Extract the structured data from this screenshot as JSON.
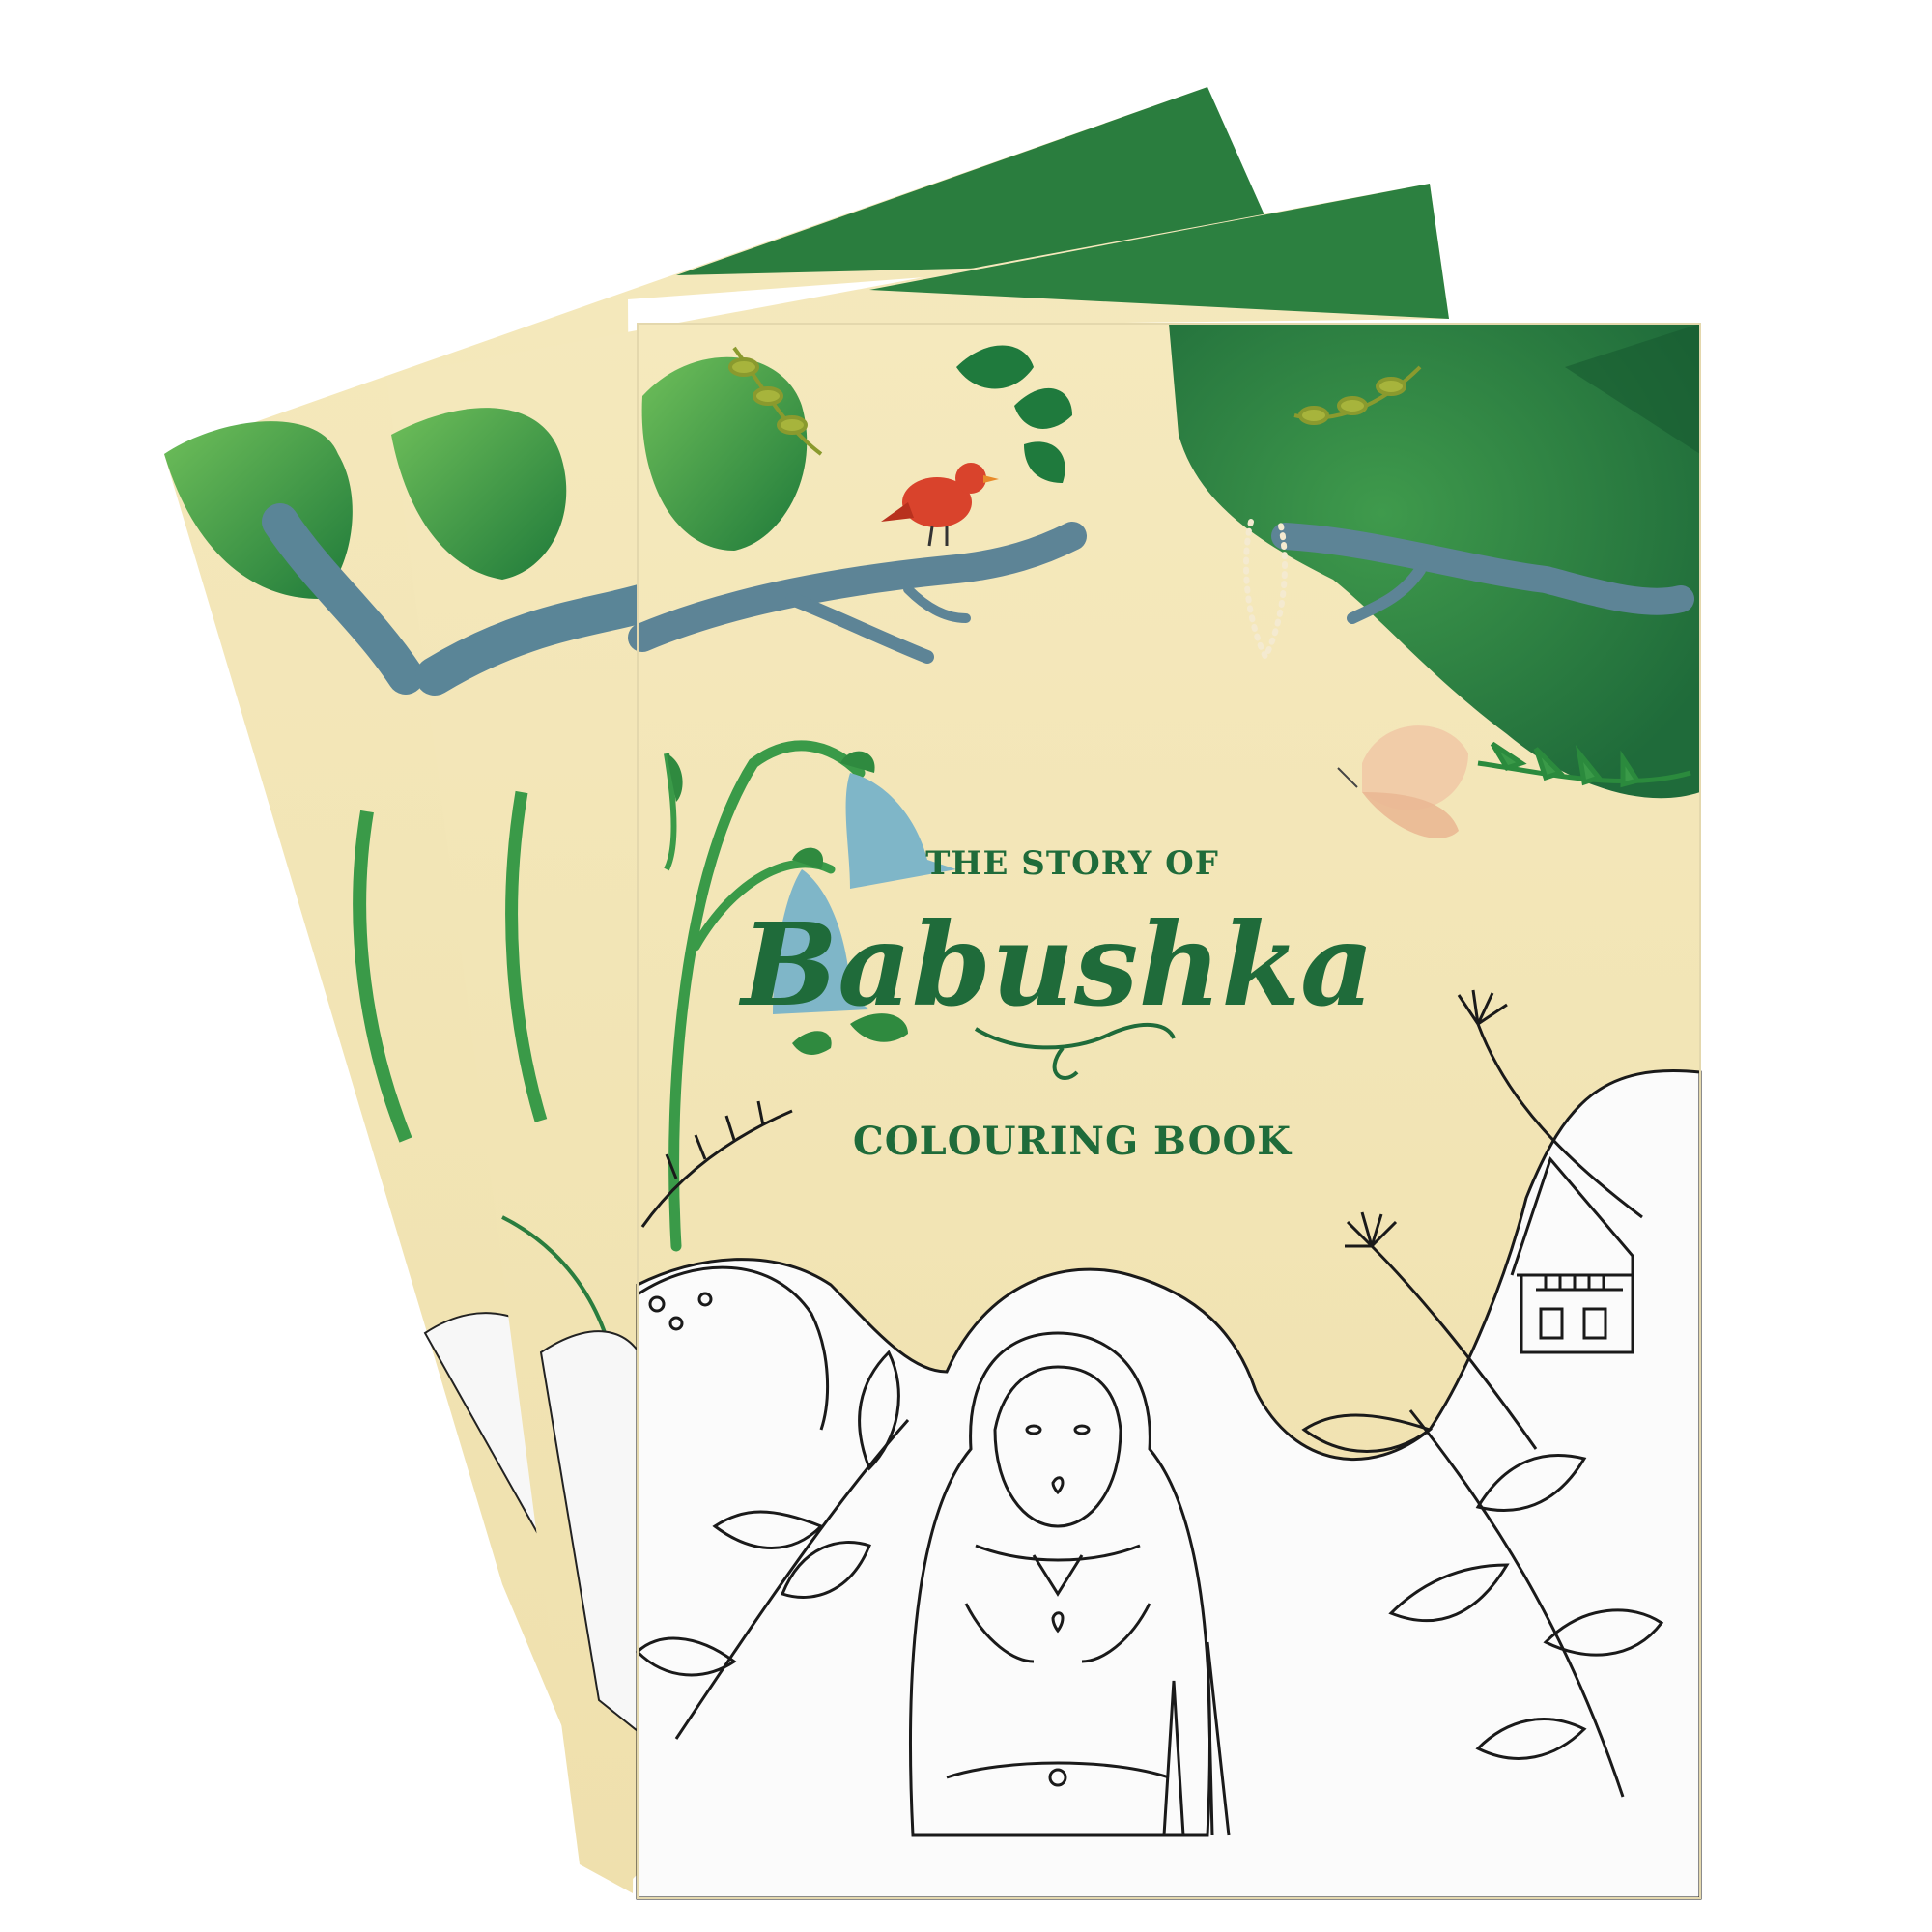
{
  "cover": {
    "title_top": "THE STORY OF",
    "title_main": "Babushka",
    "title_bottom": "COLOURING BOOK"
  },
  "colors": {
    "background": "#ffffff",
    "cover_cream": "#f3e6b8",
    "leaf_green": "#2f8a3f",
    "dark_green": "#1f6b3a",
    "olive": "#9aa83a",
    "branch_blue": "#5f8596",
    "flower_blue": "#7fb6c8",
    "bird_red": "#d9432c",
    "butterfly": "#f0c9a8",
    "title_green": "#1f6b3a",
    "line_art": "#1a1a1a",
    "page_white": "#fafafa"
  },
  "icons": [
    "bird-icon",
    "butterfly-icon",
    "bellflower-icon",
    "matryoshka-doll-icon",
    "house-icon",
    "dandelion-icon"
  ]
}
